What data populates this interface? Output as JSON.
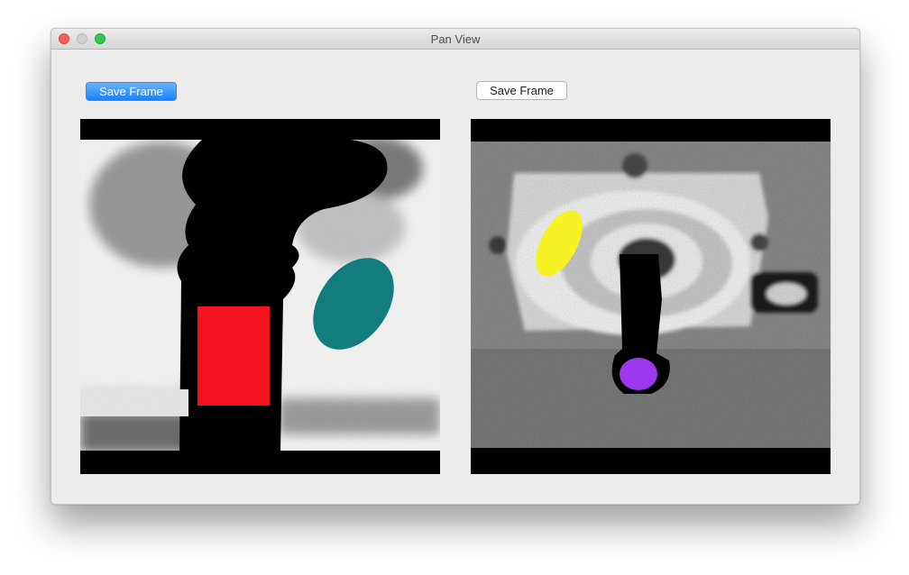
{
  "window": {
    "title": "Pan View"
  },
  "toolbar": {
    "left_save_label": "Save Frame",
    "right_save_label": "Save Frame"
  },
  "views": {
    "left": {
      "markers": [
        {
          "shape": "rectangle",
          "color": "#f5121f"
        },
        {
          "shape": "ellipse",
          "color": "#127d7d"
        }
      ]
    },
    "right": {
      "markers": [
        {
          "shape": "ellipse",
          "color": "#f6f224"
        },
        {
          "shape": "ellipse",
          "color": "#9d38f0"
        }
      ]
    }
  }
}
